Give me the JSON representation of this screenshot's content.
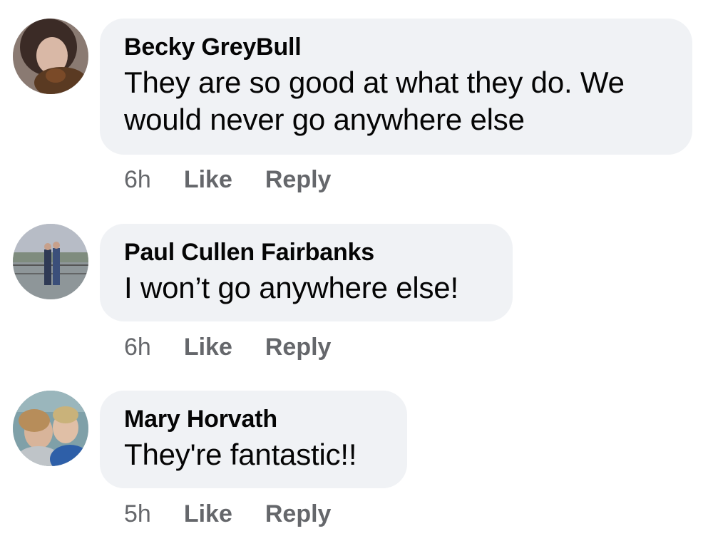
{
  "comments": [
    {
      "author": "Becky GreyBull",
      "text": "They are so good at what they do. We would never go anywhere else",
      "time": "6h",
      "like_label": "Like",
      "reply_label": "Reply"
    },
    {
      "author": "Paul Cullen Fairbanks",
      "text": "I won’t go anywhere else!",
      "time": "6h",
      "like_label": "Like",
      "reply_label": "Reply"
    },
    {
      "author": "Mary Horvath",
      "text": "They're fantastic!!",
      "time": "5h",
      "like_label": "Like",
      "reply_label": "Reply"
    }
  ],
  "colors": {
    "bubble_bg": "#f0f2f5",
    "meta_text": "#65676b",
    "primary_text": "#050505"
  }
}
